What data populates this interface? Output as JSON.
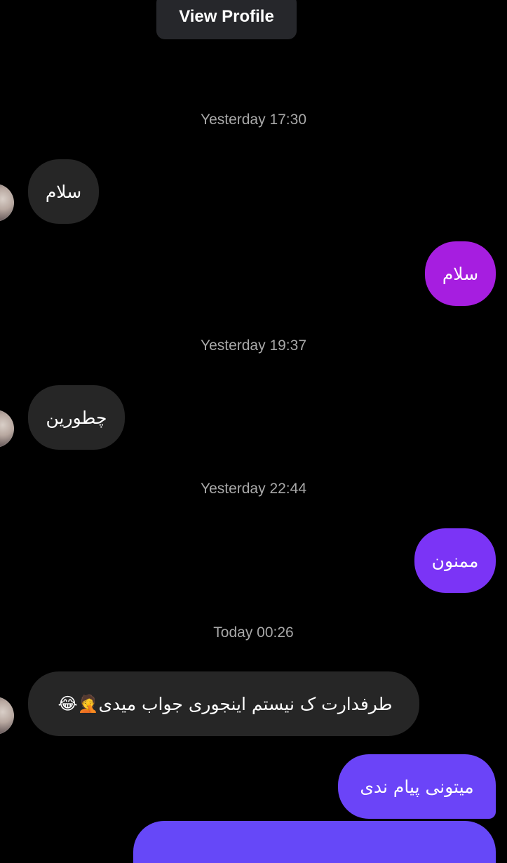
{
  "header": {
    "view_profile_label": "View Profile"
  },
  "timestamps": [
    "Yesterday 17:30",
    "Yesterday 19:37",
    "Yesterday 22:44",
    "Today 00:26"
  ],
  "messages": [
    {
      "direction": "incoming",
      "text": "سلام"
    },
    {
      "direction": "outgoing",
      "text": "سلام"
    },
    {
      "direction": "incoming",
      "text": "چطورین"
    },
    {
      "direction": "outgoing",
      "text": "ممنون"
    },
    {
      "direction": "incoming",
      "text": "طرفدارت ک نیستم اینجوری جواب میدی",
      "emojis": "😂🤦"
    },
    {
      "direction": "outgoing",
      "text": "میتونی پیام ندی"
    },
    {
      "direction": "outgoing",
      "text": ""
    }
  ],
  "colors": {
    "background": "#000000",
    "incoming_bubble": "#262626",
    "outgoing_gradient": [
      "#a61ee0",
      "#7b34f6",
      "#6b44f8",
      "#6648f8"
    ],
    "timestamp_text": "#a8a8a8"
  },
  "icons": {
    "avatar": "user-avatar-photo"
  }
}
